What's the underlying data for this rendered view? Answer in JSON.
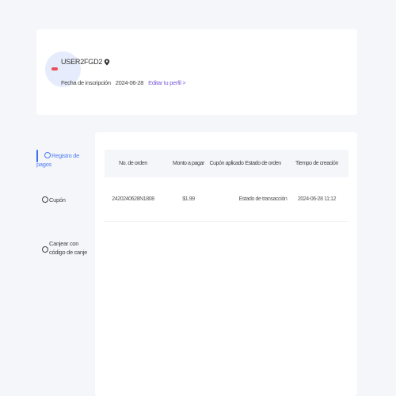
{
  "profile": {
    "username": "USER2FGD2",
    "reg_label": "Fecha de inscripción",
    "reg_date": "2024-06-28",
    "edit_link": "Editar tu perfil >",
    "accent_color": "#7b5cd6"
  },
  "nav": {
    "items": [
      {
        "label": "Registro de pagos",
        "icon": "receipt-icon",
        "active": true
      },
      {
        "label": "Cupón",
        "icon": "coupon-icon",
        "active": false
      },
      {
        "label": "Canjear con código de canje",
        "icon": "gift-icon",
        "active": false
      }
    ],
    "active_color": "#4d7cf3"
  },
  "table": {
    "columns": [
      "No. de orden",
      "Monto a pagar",
      "Cupón aplicado",
      "Estado de orden",
      "Tiempo de creación"
    ],
    "rows": [
      {
        "order_no": "2420240628N1808",
        "amount": "$1.99",
        "coupon": "",
        "status": "Estado de transacción",
        "created": "2024-06-28 11:12"
      }
    ]
  }
}
